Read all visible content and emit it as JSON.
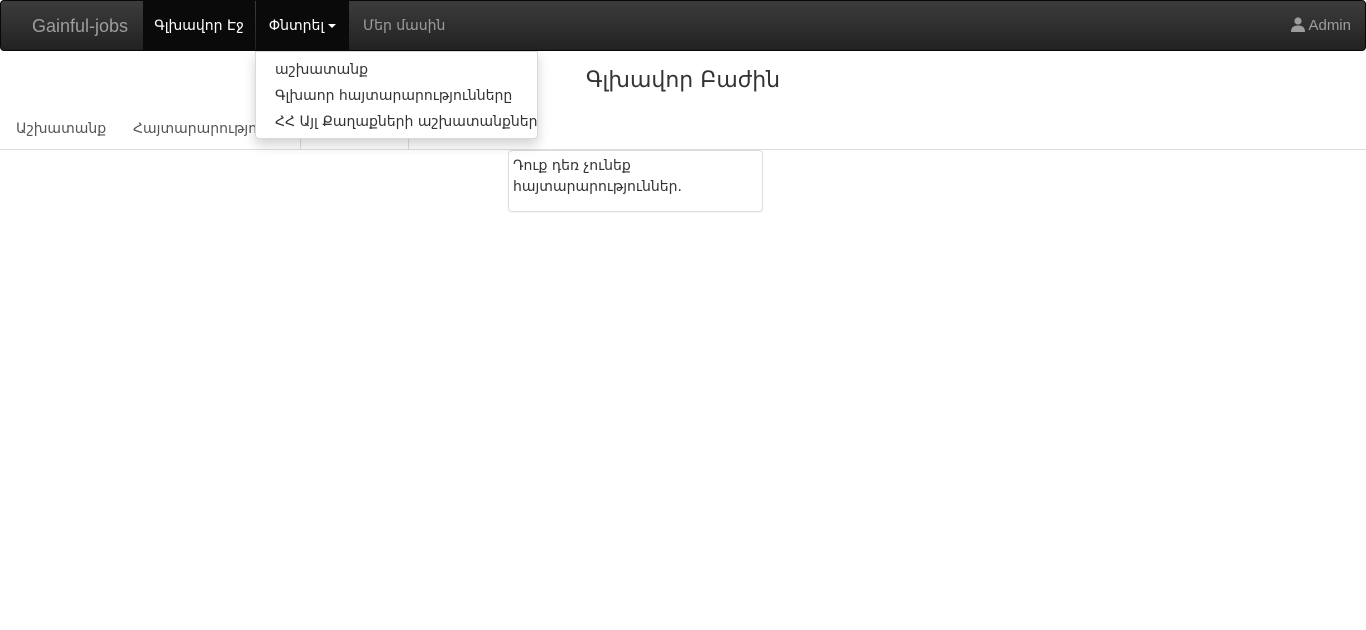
{
  "navbar": {
    "brand": "Gainful-jobs",
    "items": [
      {
        "label": "Գլխավոր Էջ",
        "active": true
      },
      {
        "label": "Փնտրել",
        "active": true,
        "dropdown": true
      },
      {
        "label": "Մեր մասին",
        "active": false
      }
    ],
    "user": {
      "icon": "user-icon",
      "label": "Admin"
    }
  },
  "dropdown": {
    "items": [
      {
        "label": "աշխատանք"
      },
      {
        "label": "Գլխաոր հայտարարությունները"
      },
      {
        "label": "ՀՀ Այլ Քաղաքների աշխատանքները"
      }
    ]
  },
  "main": {
    "title": "Գլխավոր Բաժին",
    "tabs": [
      {
        "label": "Աշխատանք"
      },
      {
        "label": "Հայտարարություններ"
      },
      {
        "label": ""
      }
    ],
    "notice": "Դուք դեռ չունեք հայտարարություններ."
  },
  "colors": {
    "navbar_bg": "#222222",
    "navbar_text": "#9d9d9d",
    "navbar_active_bg": "#0a0a0a",
    "active_text": "#ffffff"
  }
}
